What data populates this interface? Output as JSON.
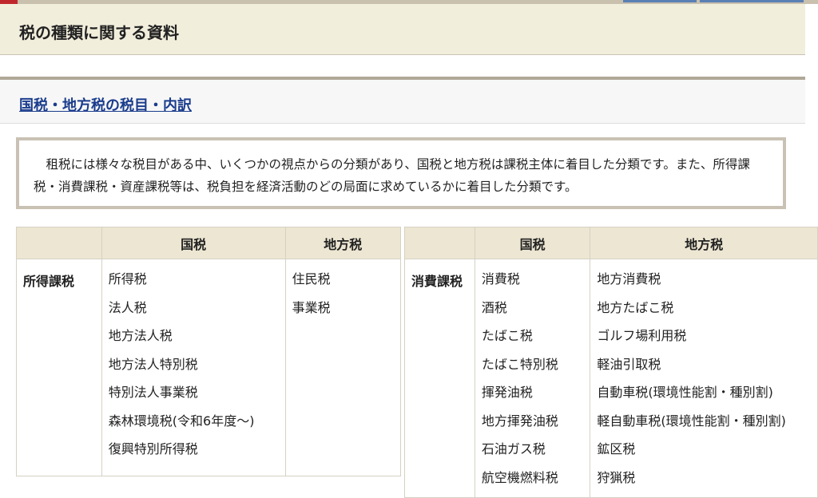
{
  "page": {
    "title": "税の種類に関する資料"
  },
  "section": {
    "link": "国税・地方税の税目・内訳"
  },
  "description": "租税には様々な税目がある中、いくつかの視点からの分類があり、国税と地方税は課税主体に着目した分類です。また、所得課税・消費課税・資産課税等は、税負担を経済活動のどの局面に求めているかに着目した分類です。",
  "tables": {
    "left": {
      "headers": [
        "",
        "国税",
        "地方税"
      ],
      "row": {
        "category": "所得課税",
        "national": [
          "所得税",
          "法人税",
          "地方法人税",
          "地方法人特別税",
          "特別法人事業税",
          "森林環境税(令和6年度～)",
          "復興特別所得税"
        ],
        "local": [
          "住民税",
          "事業税"
        ]
      }
    },
    "right": {
      "headers": [
        "",
        "国税",
        "地方税"
      ],
      "row": {
        "category": "消費課税",
        "national": [
          "消費税",
          "酒税",
          "たばこ税",
          "たばこ特別税",
          "揮発油税",
          "地方揮発油税",
          "石油ガス税",
          "航空機燃料税"
        ],
        "local": [
          "地方消費税",
          "地方たばこ税",
          "ゴルフ場利用税",
          "軽油引取税",
          "自動車税(環境性能割・種別割)",
          "軽自動車税(環境性能割・種別割)",
          "鉱区税",
          "狩猟税"
        ]
      }
    }
  },
  "colors": {
    "accent_red": "#c0272d",
    "link_blue": "#1a3c8c",
    "header_bg": "#f2eedc",
    "table_header_bg": "#ece6d2"
  }
}
